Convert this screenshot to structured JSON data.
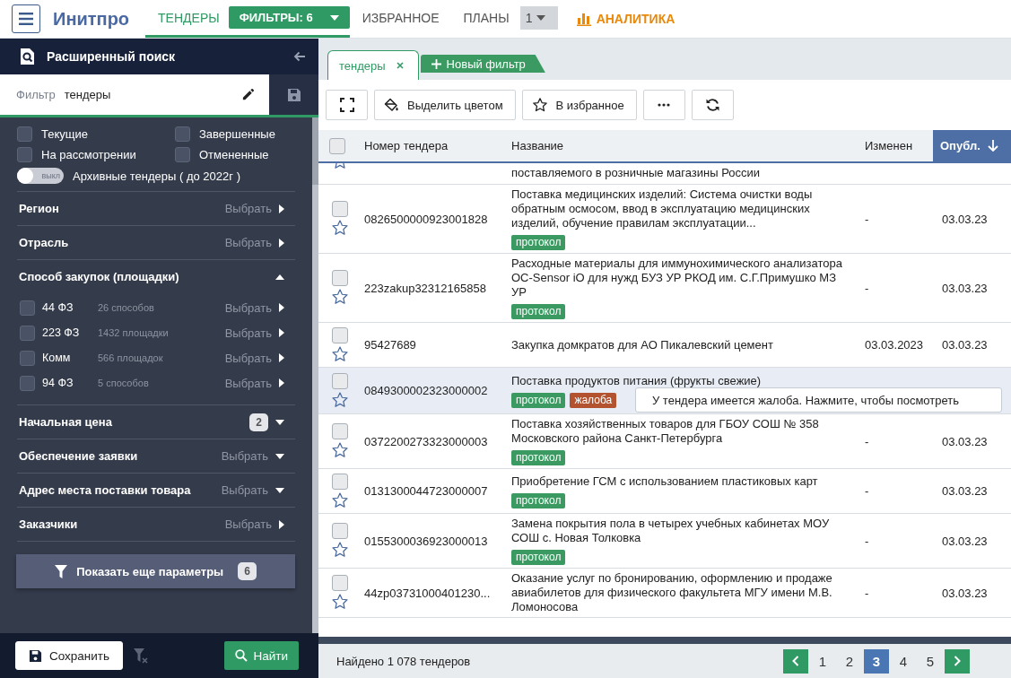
{
  "topbar": {
    "logo": "Инитпро",
    "nav": [
      {
        "kind": "tab",
        "label": "ТЕНДЕРЫ",
        "selected": true,
        "filter_button": "ФИЛЬТРЫ: 6"
      },
      {
        "kind": "tab",
        "label": "ИЗБРАННОЕ",
        "selected": false
      },
      {
        "kind": "tab",
        "label": "ПЛАНЫ",
        "selected": false,
        "counter": "1"
      },
      {
        "kind": "analytics",
        "label": "АНАЛИТИКА"
      }
    ]
  },
  "sidebar": {
    "title": "Расширенный поиск",
    "filter_label": "Фильтр",
    "filter_value": "тендеры",
    "statuses": [
      {
        "label": "Текущие",
        "checked": false
      },
      {
        "label": "Завершенные",
        "checked": false
      },
      {
        "label": "На рассмотрении",
        "checked": false
      },
      {
        "label": "Отмененные",
        "checked": false
      }
    ],
    "archive_toggle": {
      "on": false,
      "state_label": "выкл",
      "label": "Архивные тендеры ( до 2022г )"
    },
    "sections": [
      {
        "title": "Регион",
        "kind": "link",
        "action": "Выбрать"
      },
      {
        "title": "Отрасль",
        "kind": "link",
        "action": "Выбрать"
      },
      {
        "title": "Способ закупок (площадки)",
        "kind": "dropdown",
        "expanded": true,
        "children": [
          {
            "label": "44 ФЗ",
            "note": "26 способов",
            "action": "Выбрать",
            "checked": false
          },
          {
            "label": "223 ФЗ",
            "note": "1432 площадки",
            "action": "Выбрать",
            "checked": false
          },
          {
            "label": "Комм",
            "note": "566 площадок",
            "action": "Выбрать",
            "checked": false
          },
          {
            "label": "94 ФЗ",
            "note": "5 способов",
            "action": "Выбрать",
            "checked": false
          }
        ]
      },
      {
        "title": "Начальная цена",
        "kind": "dropdown",
        "expanded": false,
        "badge": "2"
      },
      {
        "title": "Обеспечение заявки",
        "kind": "dropdown",
        "expanded": false,
        "action": "Выбрать"
      },
      {
        "title": "Адрес места поставки товара",
        "kind": "dropdown",
        "expanded": false,
        "action": "Выбрать"
      },
      {
        "title": "Заказчики",
        "kind": "link",
        "action": "Выбрать"
      }
    ],
    "more_button": {
      "label": "Показать еще параметры",
      "count": "6"
    },
    "save_button": "Сохранить",
    "find_button": "Найти"
  },
  "main": {
    "tabs": [
      {
        "kind": "filter",
        "label": "тендеры",
        "selected": true
      },
      {
        "kind": "add",
        "label": "Новый фильтр"
      }
    ],
    "toolbar": [
      {
        "kind": "fullscreen"
      },
      {
        "kind": "color",
        "label": "Выделить цветом"
      },
      {
        "kind": "favorite",
        "label": "В избранное"
      },
      {
        "kind": "more"
      },
      {
        "kind": "refresh"
      }
    ],
    "table": {
      "select_all_checked": false,
      "columns": [
        {
          "label": "Номер тендера",
          "sorted": false
        },
        {
          "label": "Название",
          "sorted": false
        },
        {
          "label": "Изменен",
          "sorted": false
        },
        {
          "label": "Опубл.",
          "sorted": true
        }
      ],
      "rows": [
        {
          "kind": "partial",
          "name": "поставляемого в розничные магазины России"
        },
        {
          "kind": "tender",
          "checked": false,
          "hovered": false,
          "number": "0826500000923001828",
          "name": "Поставка медицинских изделий: Система очистки воды обратным осмосом, ввод в эксплуатацию медицинских изделий, обучение правилам эксплуатации...",
          "changed": "-",
          "published": "03.03.23",
          "tags": [
            {
              "label": "протокол",
              "color": "#3a9a62"
            }
          ]
        },
        {
          "kind": "tender",
          "checked": false,
          "hovered": false,
          "number": "223zakup32312165858",
          "name": "Расходные материалы для иммунохимического анализатора OC-Sensor iO для нужд БУЗ УР РКОД им. С.Г.Примушко МЗ УР",
          "changed": "-",
          "published": "03.03.23",
          "tags": [
            {
              "label": "протокол",
              "color": "#3a9a62"
            }
          ]
        },
        {
          "kind": "tender",
          "checked": false,
          "hovered": false,
          "number": "95427689",
          "name": "Закупка домкратов для АО Пикалевский цемент",
          "changed": "03.03.2023",
          "published": "03.03.23"
        },
        {
          "kind": "tender",
          "checked": false,
          "hovered": true,
          "number": "0849300002323000002",
          "name": "Поставка продуктов питания (фрукты свежие)",
          "tags": [
            {
              "label": "протокол",
              "color": "#3a9a62"
            },
            {
              "label": "жалоба",
              "color": "#b3522f"
            }
          ],
          "tooltip": "У тендера имеется жалоба. Нажмите, чтобы посмотреть"
        },
        {
          "kind": "tender",
          "checked": false,
          "hovered": false,
          "number": "0372200273323000003",
          "name": "Поставка хозяйственных товаров для ГБОУ СОШ № 358 Московского района Санкт-Петербурга",
          "changed": "-",
          "published": "03.03.23",
          "tags": [
            {
              "label": "протокол",
              "color": "#3a9a62"
            }
          ]
        },
        {
          "kind": "tender",
          "checked": false,
          "hovered": false,
          "number": "0131300044723000007",
          "name": "Приобретение ГСМ с использованием пластиковых карт",
          "changed": "-",
          "published": "03.03.23",
          "tags": [
            {
              "label": "протокол",
              "color": "#3a9a62"
            }
          ]
        },
        {
          "kind": "tender",
          "checked": false,
          "hovered": false,
          "number": "0155300036923000013",
          "name": "Замена покрытия пола в четырех учебных  кабинетах  МОУ СОШ с. Новая Толковка",
          "changed": "-",
          "published": "03.03.23",
          "tags": [
            {
              "label": "протокол",
              "color": "#3a9a62"
            }
          ]
        },
        {
          "kind": "tender",
          "checked": false,
          "hovered": false,
          "number": "44zp03731000401230...",
          "name": "Оказание услуг по бронированию, оформлению и продаже авиабилетов для физического факультета МГУ имени М.В. Ломоносова",
          "changed": "-",
          "published": "03.03.23"
        }
      ]
    },
    "footer": {
      "found": "Найдено 1 078 тендеров",
      "pages": [
        {
          "label": "1",
          "selected": false
        },
        {
          "label": "2",
          "selected": false
        },
        {
          "label": "3",
          "selected": true
        },
        {
          "label": "4",
          "selected": false
        },
        {
          "label": "5",
          "selected": false
        }
      ]
    }
  }
}
